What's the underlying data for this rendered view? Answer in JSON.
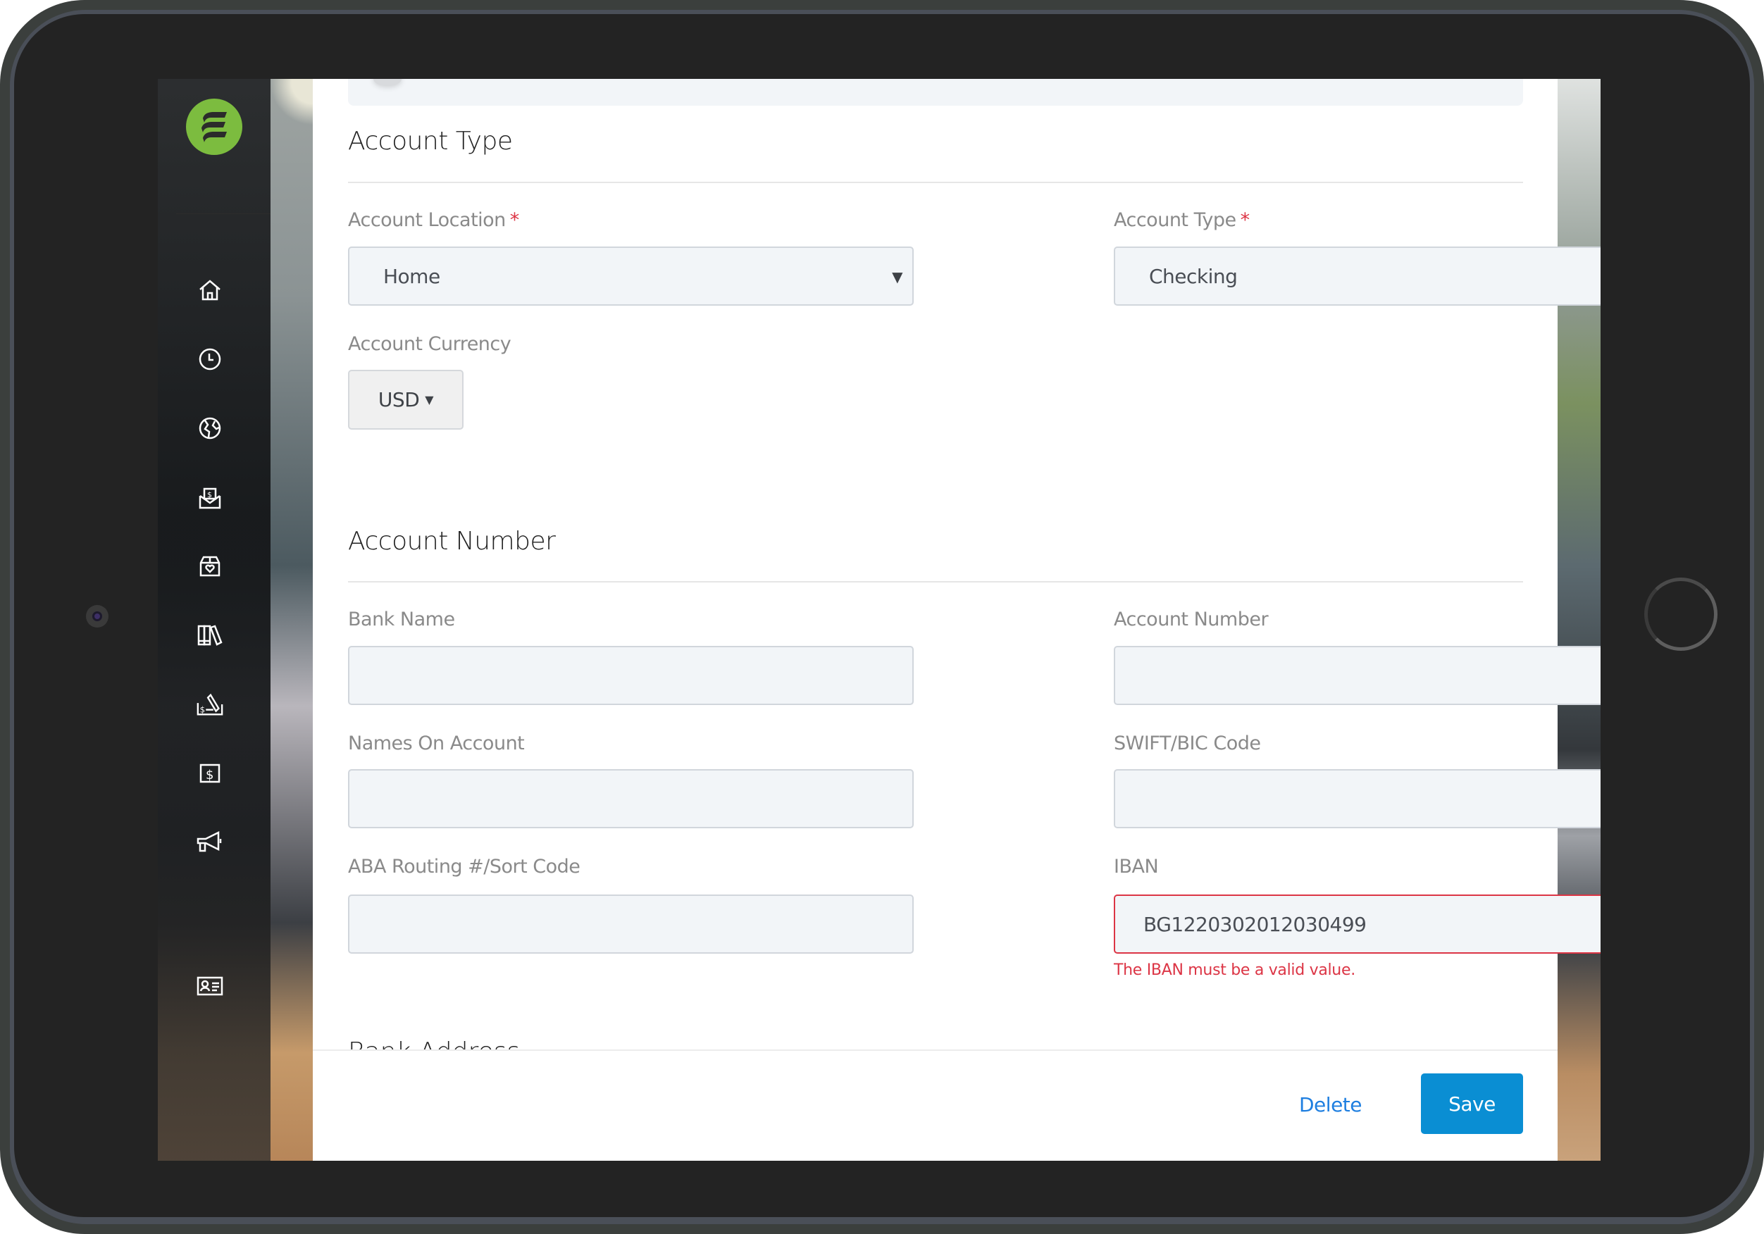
{
  "sidebar": {
    "logo": "app-logo",
    "items": [
      {
        "icon": "home-icon"
      },
      {
        "icon": "clock-icon"
      },
      {
        "icon": "globe-icon"
      },
      {
        "icon": "money-envelope-icon"
      },
      {
        "icon": "heart-box-icon"
      },
      {
        "icon": "library-icon"
      },
      {
        "icon": "check-signing-icon"
      },
      {
        "icon": "dollar-bill-icon"
      },
      {
        "icon": "megaphone-icon"
      },
      {
        "icon": "contact-card-icon"
      }
    ]
  },
  "account_type_section": {
    "title": "Account Type",
    "location": {
      "label": "Account Location",
      "required_mark": "*",
      "value": "Home"
    },
    "type": {
      "label": "Account Type",
      "required_mark": "*",
      "value": "Checking"
    },
    "currency": {
      "label": "Account Currency",
      "value": "USD"
    }
  },
  "account_number_section": {
    "title": "Account Number",
    "bank_name": {
      "label": "Bank Name",
      "value": ""
    },
    "account_number": {
      "label": "Account Number",
      "value": ""
    },
    "names_on_account": {
      "label": "Names On Account",
      "value": ""
    },
    "swift_bic": {
      "label": "SWIFT/BIC Code",
      "value": ""
    },
    "aba_routing": {
      "label": "ABA Routing #/Sort Code",
      "value": ""
    },
    "iban": {
      "label": "IBAN",
      "value": "BG1220302012030499",
      "error": "The IBAN must be a valid value.",
      "clear_icon": "✖"
    }
  },
  "next_section": {
    "title": "Bank Address"
  },
  "footer": {
    "delete_label": "Delete",
    "save_label": "Save"
  },
  "colors": {
    "brand_green": "#7cbc3f",
    "primary_blue": "#0a8ed3",
    "link_blue": "#1f7fe0",
    "error_red": "#dc3545"
  }
}
